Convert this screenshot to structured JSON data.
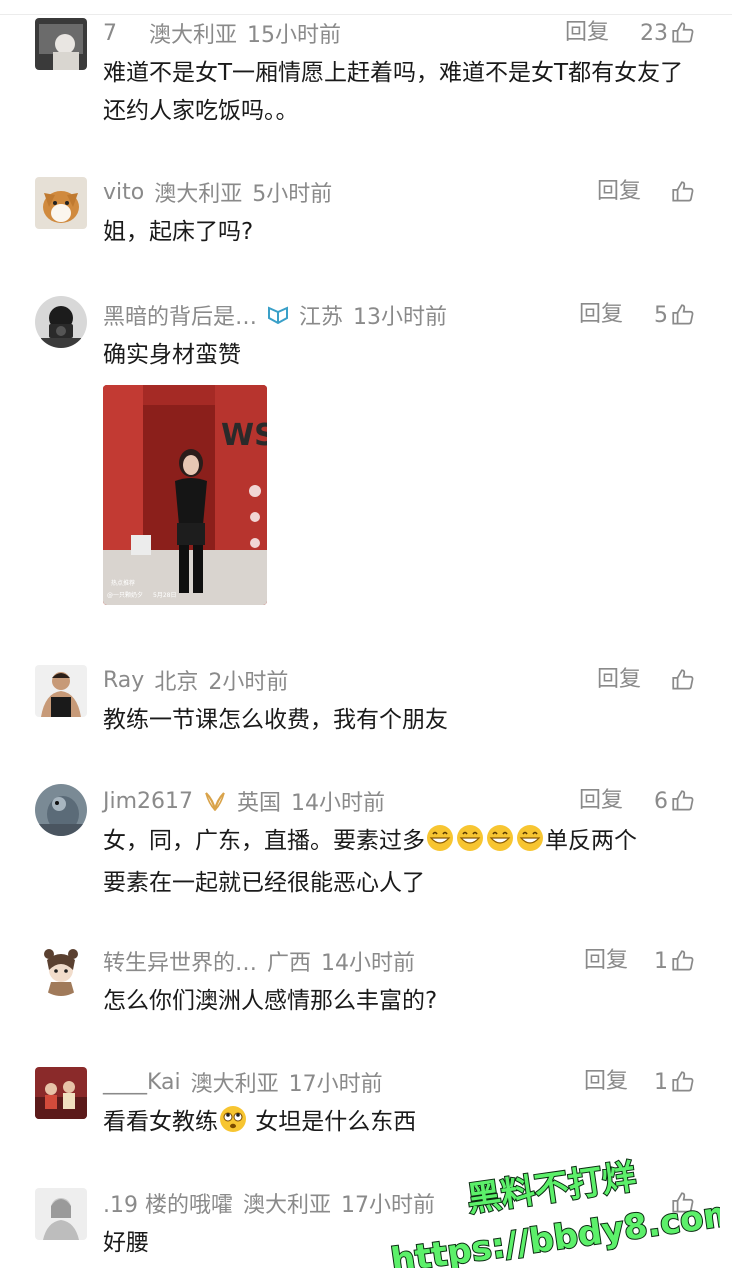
{
  "reply_label": "回复",
  "comments": [
    {
      "user": "7",
      "location": "澳大利亚",
      "time": "15小时前",
      "likes": "23",
      "text": "难道不是女T一厢情愿上赶着吗，难道不是女T都有女友了还约人家吃饭吗。。"
    },
    {
      "user": "vito",
      "location": "澳大利亚",
      "time": "5小时前",
      "likes": "",
      "text": "姐，起床了吗?"
    },
    {
      "user": "黑暗的背后是…",
      "location": "江苏",
      "time": "13小时前",
      "likes": "5",
      "text": "确实身材蛮赞"
    },
    {
      "user": "Ray",
      "location": "北京",
      "time": "2小时前",
      "likes": "",
      "text": "教练一节课怎么收费，我有个朋友"
    },
    {
      "user": "Jim2617",
      "location": "英国",
      "time": "14小时前",
      "likes": "6",
      "text_a": "女，同，广东，直播。要素过多",
      "text_b": "单反两个",
      "text_c": "要素在一起就已经很能恶心人了"
    },
    {
      "user": "转生异世界的…",
      "location": "广西",
      "time": "14小时前",
      "likes": "1",
      "text": "怎么你们澳洲人感情那么丰富的?"
    },
    {
      "user": "____Kai",
      "location": "澳大利亚",
      "time": "17小时前",
      "likes": "1",
      "text_a": "看看女教练",
      "text_b": " 女坦是什么东西"
    },
    {
      "user": ".19 楼的哦嚯",
      "location": "澳大利亚",
      "time": "17小时前",
      "likes": "",
      "text": "好腰"
    }
  ],
  "photo": {
    "sign": "WS",
    "caption": "@一只颗奶夕",
    "date": "5月28日",
    "tag": "热点推荐"
  },
  "watermark": {
    "line1": "黑料不打烊",
    "line2": "https://bbdy8.com"
  },
  "icons": {
    "like": "thumbs-up-icon",
    "vip_badge": "vip-badge-icon",
    "emoji_grin": "grin-emoji-icon",
    "emoji_roll": "eye-roll-emoji-icon"
  }
}
